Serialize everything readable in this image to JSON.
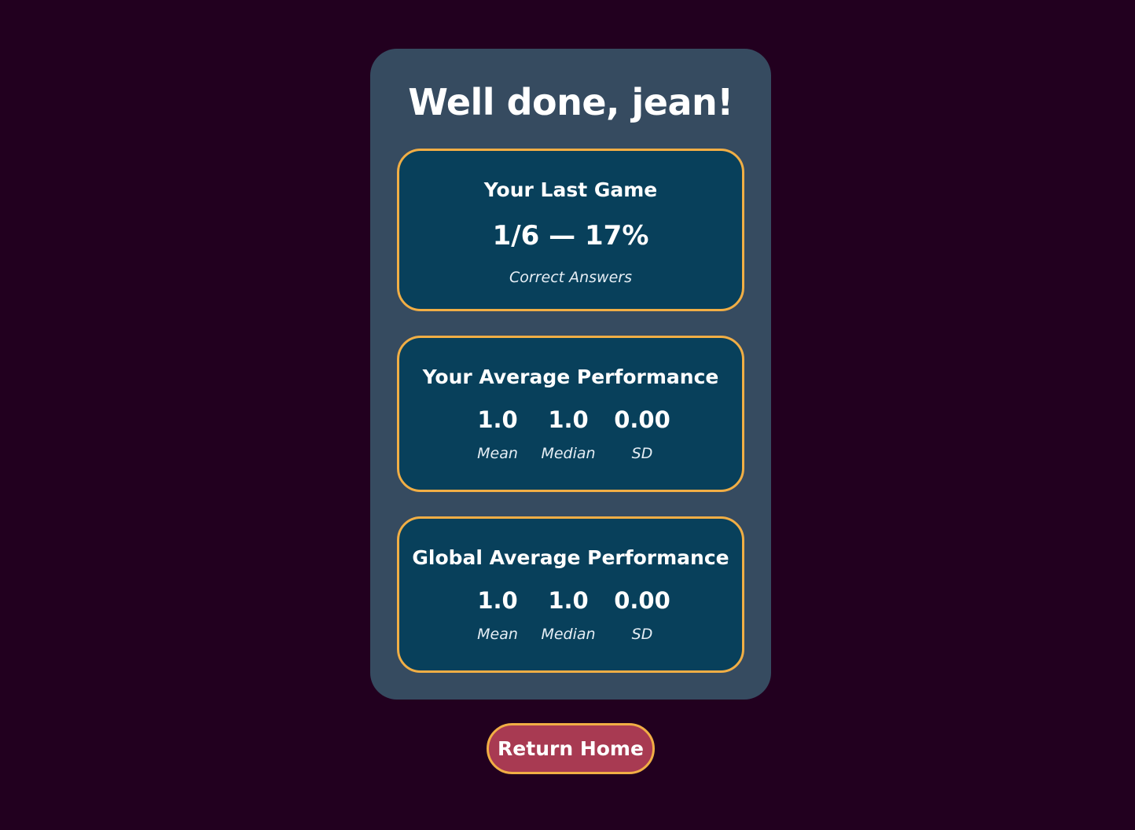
{
  "header": {
    "title": "Well done, jean!"
  },
  "last_game": {
    "heading": "Your Last Game",
    "score": "1/6 — 17%",
    "caption": "Correct Answers"
  },
  "your_average": {
    "heading": "Your Average Performance",
    "mean": "1.0",
    "median": "1.0",
    "sd": "0.00",
    "mean_label": "Mean",
    "median_label": "Median",
    "sd_label": "SD"
  },
  "global_average": {
    "heading": "Global Average Performance",
    "mean": "1.0",
    "median": "1.0",
    "sd": "0.00",
    "mean_label": "Mean",
    "median_label": "Median",
    "sd_label": "SD"
  },
  "actions": {
    "return_home_label": "Return Home"
  },
  "colors": {
    "background": "#22001f",
    "panel": "#364b60",
    "card": "#08405b",
    "accent_border": "#f1ae45",
    "button": "#a83a52"
  }
}
